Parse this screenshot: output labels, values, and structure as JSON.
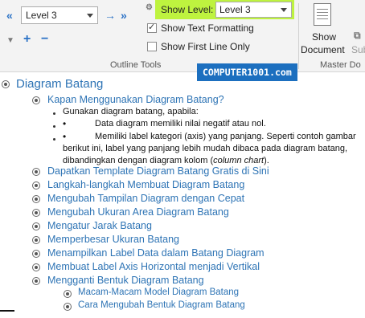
{
  "ribbon": {
    "level_select": "Level 3",
    "show_level_label": "Show Level:",
    "show_level_value": "Level 3",
    "show_text_formatting": "Show Text Formatting",
    "show_first_line_only": "Show First Line Only",
    "group_outline_tools": "Outline Tools",
    "show_document_label_line1": "Show",
    "show_document_label_line2": "Document",
    "sub_label": "Sub",
    "group_master_doc": "Master Do",
    "highlight_color": "#bef33f"
  },
  "watermark": "COMPUTER1001.com",
  "outline": {
    "title": "Diagram Batang",
    "items": [
      "Kapan Menggunakan Diagram Batang?",
      "Dapatkan Template Diagram Batang Gratis di Sini",
      "Langkah-langkah Membuat Diagram Batang",
      "Mengubah Tampilan Diagram dengan Cepat",
      "Mengubah Ukuran Area Diagram Batang",
      "Mengatur Jarak Batang",
      "Memperbesar Ukuran Batang",
      "Menampilkan Label Data dalam Batang Diagram",
      "Membuat Label Axis Horizontal menjadi Vertikal",
      "Mengganti Bentuk Diagram Batang"
    ],
    "body": {
      "intro": "Gunakan diagram batang, apabila:",
      "bullet1": "Data diagram memiliki nilai negatif atau nol.",
      "bullet2": "Memiliki label kategori (axis) yang panjang. Seperti contoh gambar",
      "line2": "berikut ini, label yang panjang lebih mudah dibaca pada diagram batang,",
      "line3_a": "dibandingkan dengan diagram kolom (",
      "line3_b": "column chart",
      "line3_c": ")."
    },
    "subitems": [
      "Macam-Macam Model Diagram Batang",
      "Cara Mengubah Bentuk Diagram Batang"
    ]
  }
}
